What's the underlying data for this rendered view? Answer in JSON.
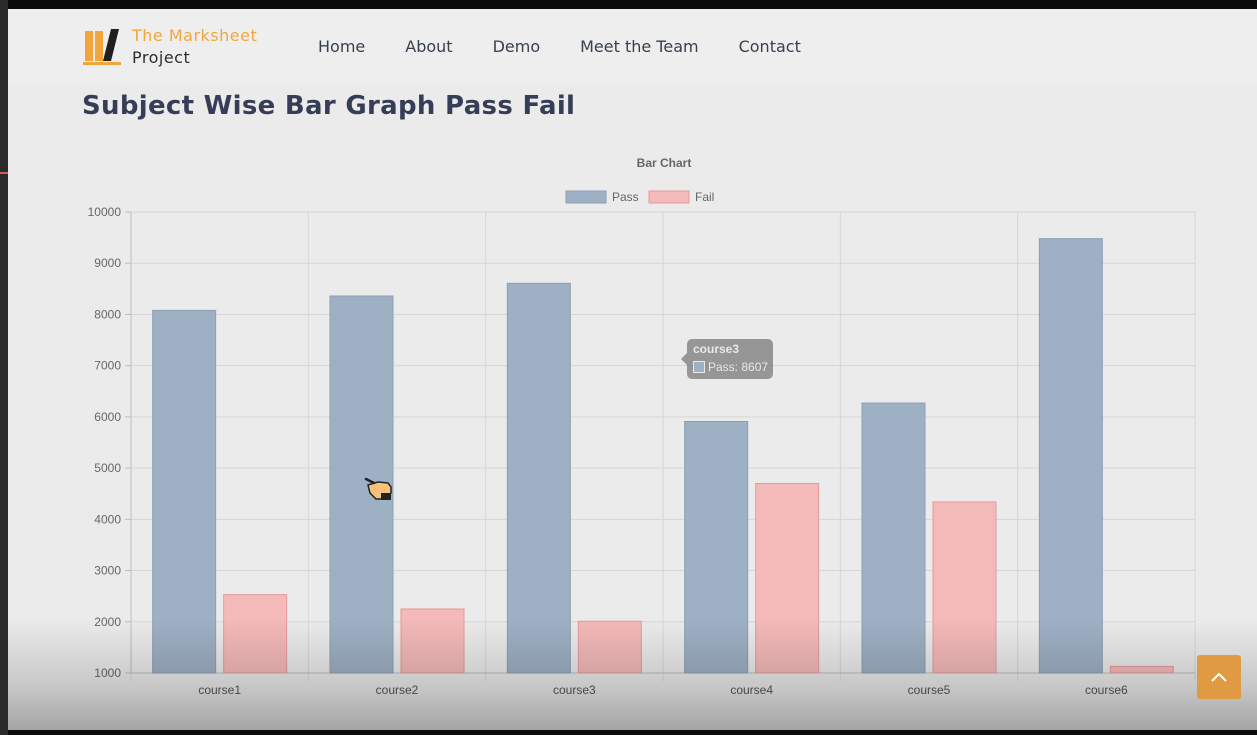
{
  "site": {
    "brand_line1": "The Marksheet",
    "brand_line2": "Project",
    "nav": [
      "Home",
      "About",
      "Demo",
      "Meet the Team",
      "Contact"
    ],
    "page_title": "Subject Wise Bar Graph Pass Fail"
  },
  "tooltip": {
    "title": "course3",
    "text": "Pass: 8607"
  },
  "colors": {
    "pass_fill": "#9eb0c4",
    "pass_border": "#8c9fb4",
    "fail_fill": "#f4b9b9",
    "fail_border": "#e69a9a",
    "accent": "#f2a53a"
  },
  "icons": {
    "scroll_top": "chevron-up-icon",
    "logo": "books-logo-icon",
    "cursor": "hand-pointer-icon"
  },
  "chart_data": {
    "type": "bar",
    "title": "Bar Chart",
    "categories": [
      "course1",
      "course2",
      "course3",
      "course4",
      "course5",
      "course6"
    ],
    "series": [
      {
        "name": "Pass",
        "values": [
          8080,
          8360,
          8607,
          5910,
          6270,
          9480
        ]
      },
      {
        "name": "Fail",
        "values": [
          2530,
          2250,
          2010,
          4700,
          4340,
          1130
        ]
      }
    ],
    "ylim": [
      1000,
      10000
    ],
    "yticks": [
      1000,
      2000,
      3000,
      4000,
      5000,
      6000,
      7000,
      8000,
      9000,
      10000
    ],
    "grid": true,
    "legend": "top"
  }
}
